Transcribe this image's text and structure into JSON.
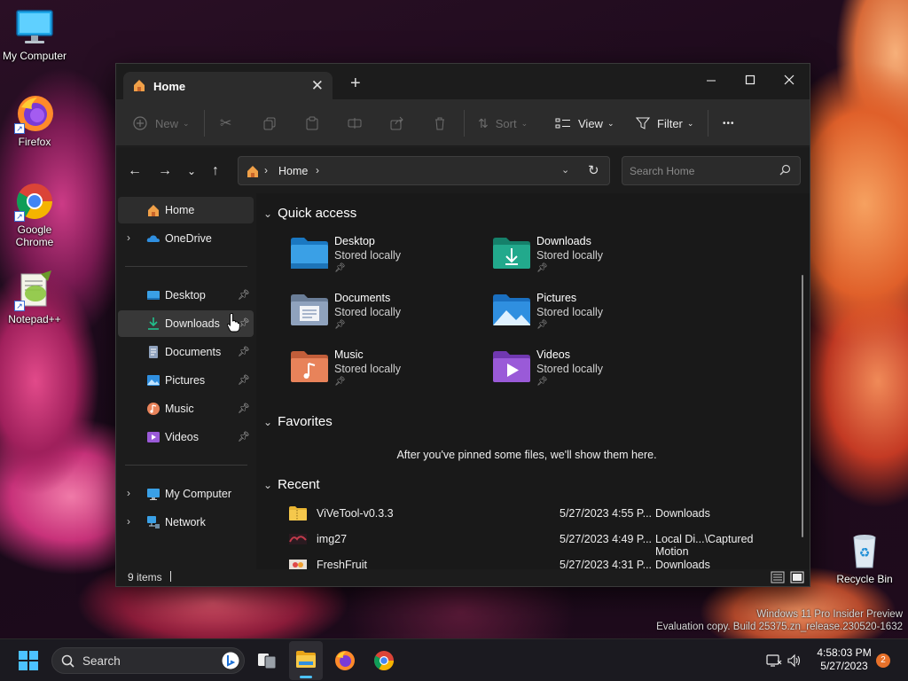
{
  "desktop": {
    "icons": [
      {
        "label": "My Computer"
      },
      {
        "label": "Firefox"
      },
      {
        "label": "Google Chrome"
      },
      {
        "label": "Notepad++"
      },
      {
        "label": "Recycle Bin"
      }
    ],
    "watermark": {
      "line1": "Windows 11 Pro Insider Preview",
      "line2": "Evaluation copy. Build 25375.zn_release.230520-1632"
    }
  },
  "window": {
    "tab_title": "Home",
    "new_tab_glyph": "+",
    "controls": {
      "minimize": "—",
      "maximize": "☐",
      "close": "✕"
    },
    "toolbar": {
      "new_label": "New",
      "sort_label": "Sort",
      "view_label": "View",
      "filter_label": "Filter",
      "more_glyph": "•••"
    },
    "address": {
      "crumb": "Home"
    },
    "search": {
      "placeholder": "Search Home"
    },
    "sidebar": {
      "home": "Home",
      "onedrive": "OneDrive",
      "pinned": [
        {
          "label": "Desktop",
          "icon": "desktop-icon"
        },
        {
          "label": "Downloads",
          "icon": "downloads-icon"
        },
        {
          "label": "Documents",
          "icon": "documents-icon"
        },
        {
          "label": "Pictures",
          "icon": "pictures-icon"
        },
        {
          "label": "Music",
          "icon": "music-icon"
        },
        {
          "label": "Videos",
          "icon": "videos-icon"
        }
      ],
      "my_computer": "My Computer",
      "network": "Network"
    },
    "quick_access": {
      "title": "Quick access",
      "items": [
        {
          "name": "Desktop",
          "sub": "Stored locally",
          "color": "#3aa0e6"
        },
        {
          "name": "Downloads",
          "sub": "Stored locally",
          "color": "#22a98c"
        },
        {
          "name": "Documents",
          "sub": "Stored locally",
          "color": "#8fa2bd"
        },
        {
          "name": "Pictures",
          "sub": "Stored locally",
          "color": "#2f8fe0"
        },
        {
          "name": "Music",
          "sub": "Stored locally",
          "color": "#e8835a"
        },
        {
          "name": "Videos",
          "sub": "Stored locally",
          "color": "#9a5ad8"
        }
      ]
    },
    "favorites": {
      "title": "Favorites",
      "empty_text": "After you've pinned some files, we'll show them here."
    },
    "recent": {
      "title": "Recent",
      "rows": [
        {
          "name": "ViVeTool-v0.3.3",
          "date": "5/27/2023 4:55 P...",
          "location": "Downloads"
        },
        {
          "name": "img27",
          "date": "5/27/2023 4:49 P...",
          "location": "Local Di...\\Captured Motion"
        },
        {
          "name": "FreshFruit",
          "date": "5/27/2023 4:31 P...",
          "location": "Downloads"
        }
      ]
    },
    "status": {
      "count": "9 items"
    }
  },
  "taskbar": {
    "search_label": "Search",
    "time": "4:58:03 PM",
    "date": "5/27/2023",
    "notification_count": "2"
  }
}
